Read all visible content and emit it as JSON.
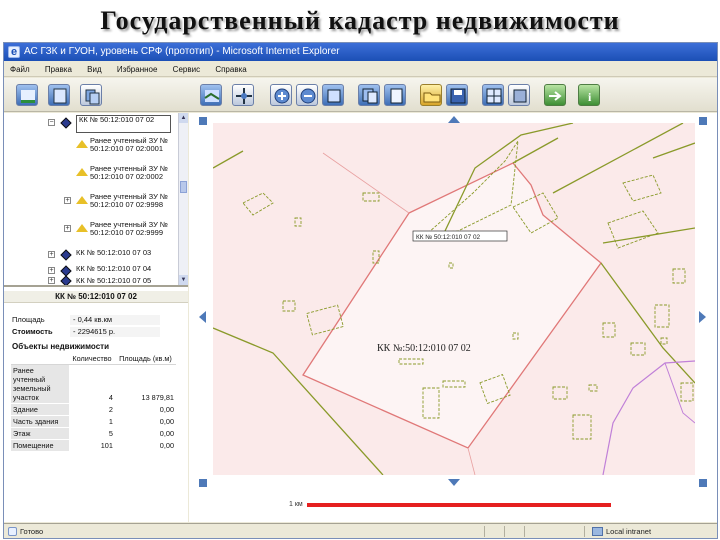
{
  "slide_title": "Государственный кадастр недвижимости",
  "window": {
    "title": "АС ГЗК и ГУОН, уровень СРФ (прототип) - Microsoft Internet Explorer",
    "menu": [
      "Файл",
      "Правка",
      "Вид",
      "Избранное",
      "Сервис",
      "Справка"
    ]
  },
  "tree": {
    "selected": "КК № 50:12:010 07 02",
    "items": [
      "Ранее учтенный ЗУ № 50:12:010 07 02:0001",
      "Ранее учтенный ЗУ № 50:12:010 07 02:0002",
      "Ранее учтенный ЗУ № 50:12:010 07 02:9998",
      "Ранее учтенный ЗУ № 50:12:010 07 02:9999"
    ],
    "others": [
      "КК № 50:12:010 07 03",
      "КК № 50:12:010 07 04",
      "КК № 50:12:010 07 05"
    ]
  },
  "info": {
    "header": "КК № 50:12:010 07 02",
    "area_label": "Площадь",
    "area_value": "- 0,44 кв.км",
    "cost_label": "Стоимость",
    "cost_value": "- 2294615 р.",
    "objects_title": "Объекты недвижимости",
    "columns": [
      "Количество",
      "Площадь (кв.м)"
    ],
    "rows": [
      {
        "name": "Ранее учтенный земельный участок",
        "count": "4",
        "area": "13 879,81"
      },
      {
        "name": "Здание",
        "count": "2",
        "area": "0,00"
      },
      {
        "name": "Часть здания",
        "count": "1",
        "area": "0,00"
      },
      {
        "name": "Этаж",
        "count": "5",
        "area": "0,00"
      },
      {
        "name": "Помещение",
        "count": "101",
        "area": "0,00"
      }
    ]
  },
  "map": {
    "main_label": "КК №:50:12:010 07 02",
    "small_label": "КК № 50:12:010 07 02",
    "scale_label": "1 км",
    "colors": {
      "boundary": "#e07878",
      "parcel": "#8a9a2a",
      "road": "#c080d8",
      "fill": "#fbeaea",
      "scale": "#e52020"
    }
  },
  "status": {
    "left": "Готово",
    "right": "Local intranet"
  },
  "icons": [
    "tree-icon",
    "layers-icon",
    "copy-icon",
    "map-icon",
    "move-icon",
    "zoom-in-icon",
    "zoom-out-icon",
    "zoom-window-icon",
    "zoom-extent-icon",
    "pages-icon",
    "folder-icon",
    "save-icon",
    "grid-icon",
    "overview-icon",
    "export-icon",
    "info-icon"
  ]
}
